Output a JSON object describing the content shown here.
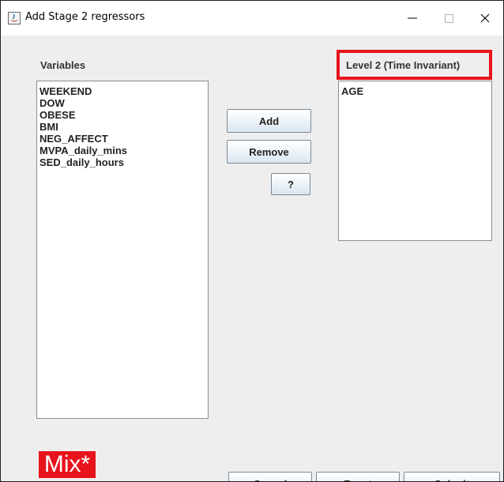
{
  "window": {
    "title": "Add Stage 2 regressors",
    "controls": {
      "minimize": "—",
      "maximize": "☐",
      "close": "✕"
    }
  },
  "variables_panel": {
    "label": "Variables",
    "items": [
      "WEEKEND",
      "DOW",
      "OBESE",
      "BMI",
      "NEG_AFFECT",
      "MVPA_daily_mins",
      "SED_daily_hours"
    ]
  },
  "level2_panel": {
    "label": "Level 2 (Time Invariant)",
    "items": [
      "AGE"
    ],
    "highlight_color": "#e8141c"
  },
  "buttons": {
    "add": "Add",
    "remove": "Remove",
    "help": "?",
    "cancel": "Cancel",
    "reset": "Reset",
    "submit": "Submit"
  },
  "logo": {
    "text": "Mix*",
    "color": "#e8141c"
  }
}
